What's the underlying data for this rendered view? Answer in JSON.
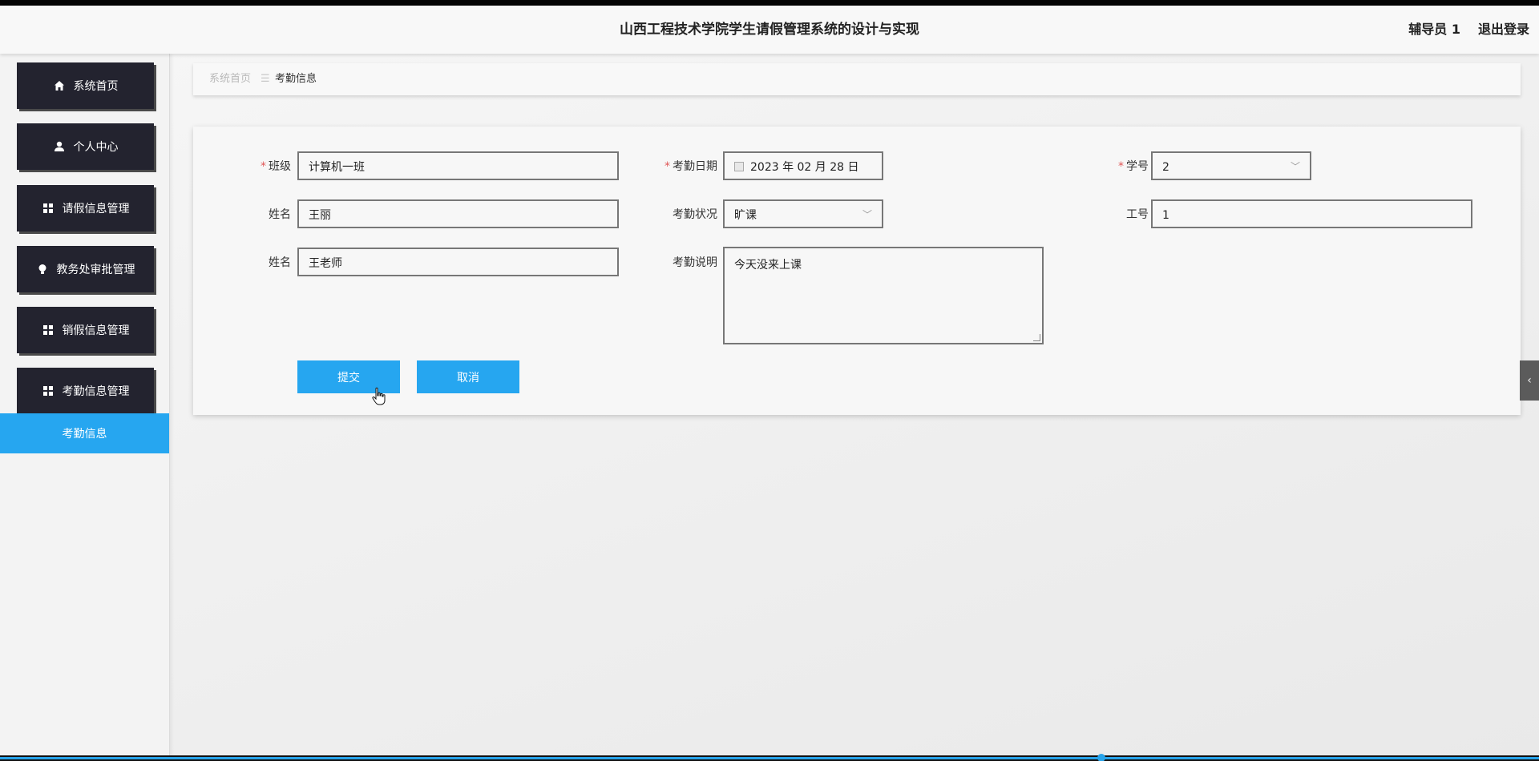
{
  "header": {
    "title": "山西工程技术学院学生请假管理系统的设计与实现",
    "user": "辅导员 1",
    "logout": "退出登录"
  },
  "sidebar": {
    "items": [
      {
        "label": "系统首页",
        "icon": "home-icon"
      },
      {
        "label": "个人中心",
        "icon": "user-icon"
      },
      {
        "label": "请假信息管理",
        "icon": "grid-icon"
      },
      {
        "label": "教务处审批管理",
        "icon": "bulb-icon"
      },
      {
        "label": "销假信息管理",
        "icon": "grid-icon"
      },
      {
        "label": "考勤信息管理",
        "icon": "grid-icon"
      }
    ],
    "active_subitem": "考勤信息"
  },
  "breadcrumb": {
    "home": "系统首页",
    "separator": "☰",
    "current": "考勤信息"
  },
  "form": {
    "required_mark": "*",
    "class_label": "班级",
    "class_value": "计算机一班",
    "date_label": "考勤日期",
    "date_value": "2023 年 02 月 28 日",
    "student_no_label": "学号",
    "student_no_value": "2",
    "name_label": "姓名",
    "name_value": "王丽",
    "status_label": "考勤状况",
    "status_value": "旷课",
    "staff_no_label": "工号",
    "staff_no_value": "1",
    "teacher_label": "姓名",
    "teacher_value": "王老师",
    "note_label": "考勤说明",
    "note_value": "今天没来上课",
    "submit": "提交",
    "cancel": "取消"
  },
  "colors": {
    "accent": "#26a6f0",
    "menu_bg": "#23232f",
    "required": "#e05656"
  }
}
